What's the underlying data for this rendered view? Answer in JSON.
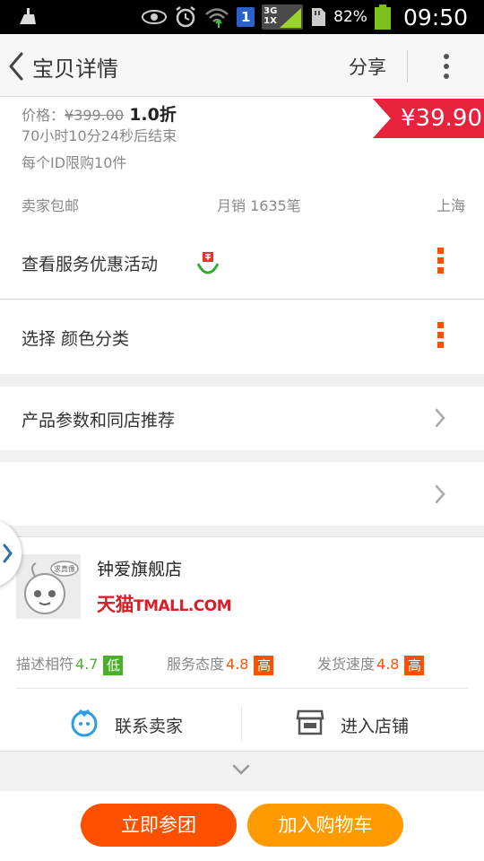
{
  "status_bar": {
    "battery": "82%",
    "time": "09:50",
    "sim": "1",
    "network_top": "3G",
    "network_bottom": "1X"
  },
  "header": {
    "title": "宝贝详情",
    "share_label": "分享"
  },
  "product": {
    "price_prefix": "价格：",
    "original_price": "¥399.00",
    "discount": "1.0折",
    "countdown": "70小时10分24秒后结束",
    "limit": "每个ID限购10件",
    "current_price": "¥39.90",
    "shipping": "卖家包邮",
    "monthly_sales": "月销 1635笔",
    "location": "上海"
  },
  "rows": {
    "service": "查看服务优惠活动",
    "select": "选择 颜色分类",
    "params": "产品参数和同店推荐"
  },
  "shop": {
    "name": "钟爱旗舰店",
    "tmall_cn": "天猫",
    "tmall_domain": "TMALL.COM",
    "desc_label": "描述相符",
    "desc_score": "4.7",
    "desc_badge": "低",
    "service_label": "服务态度",
    "service_score": "4.8",
    "service_badge": "高",
    "ship_label": "发货速度",
    "ship_score": "4.8",
    "ship_badge": "高",
    "contact_label": "联系卖家",
    "enter_label": "进入店铺",
    "logo_tag": "求真像"
  },
  "actions": {
    "group_buy": "立即参团",
    "add_cart": "加入购物车"
  },
  "colors": {
    "brand_orange": "#ff5000",
    "cart_orange": "#ff9a00",
    "price_red": "#e8223c",
    "low_green": "#4caf2a",
    "high_orange": "#ff5000"
  }
}
